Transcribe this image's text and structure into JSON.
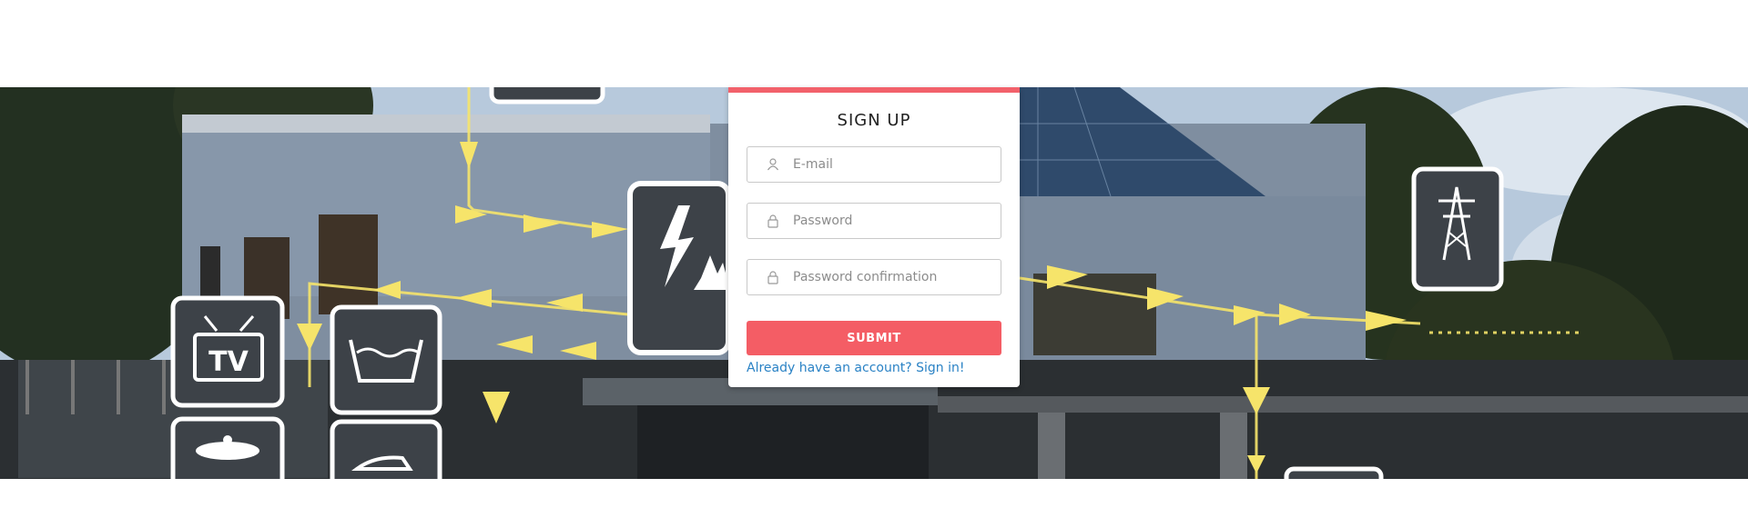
{
  "form": {
    "title": "SIGN UP",
    "fields": [
      {
        "placeholder": "E-mail",
        "value": "",
        "icon": "user-icon"
      },
      {
        "placeholder": "Password",
        "value": "",
        "icon": "lock-icon"
      },
      {
        "placeholder": "Password confirmation",
        "value": "",
        "icon": "lock-icon"
      }
    ],
    "submit_label": "SUBMIT",
    "signin_link": "Already have an account? Sign in!"
  },
  "hero": {
    "tiles": [
      {
        "icon": "high-voltage-icon"
      },
      {
        "icon": "tv-icon",
        "label": "TV"
      },
      {
        "icon": "washing-icon"
      },
      {
        "icon": "pot-icon"
      },
      {
        "icon": "iron-icon"
      },
      {
        "icon": "power-pylon-icon"
      }
    ]
  },
  "colors": {
    "accent": "#f45d65",
    "link": "#2a82c5",
    "arrow": "#f6e46a",
    "tile": "#3d4248"
  }
}
